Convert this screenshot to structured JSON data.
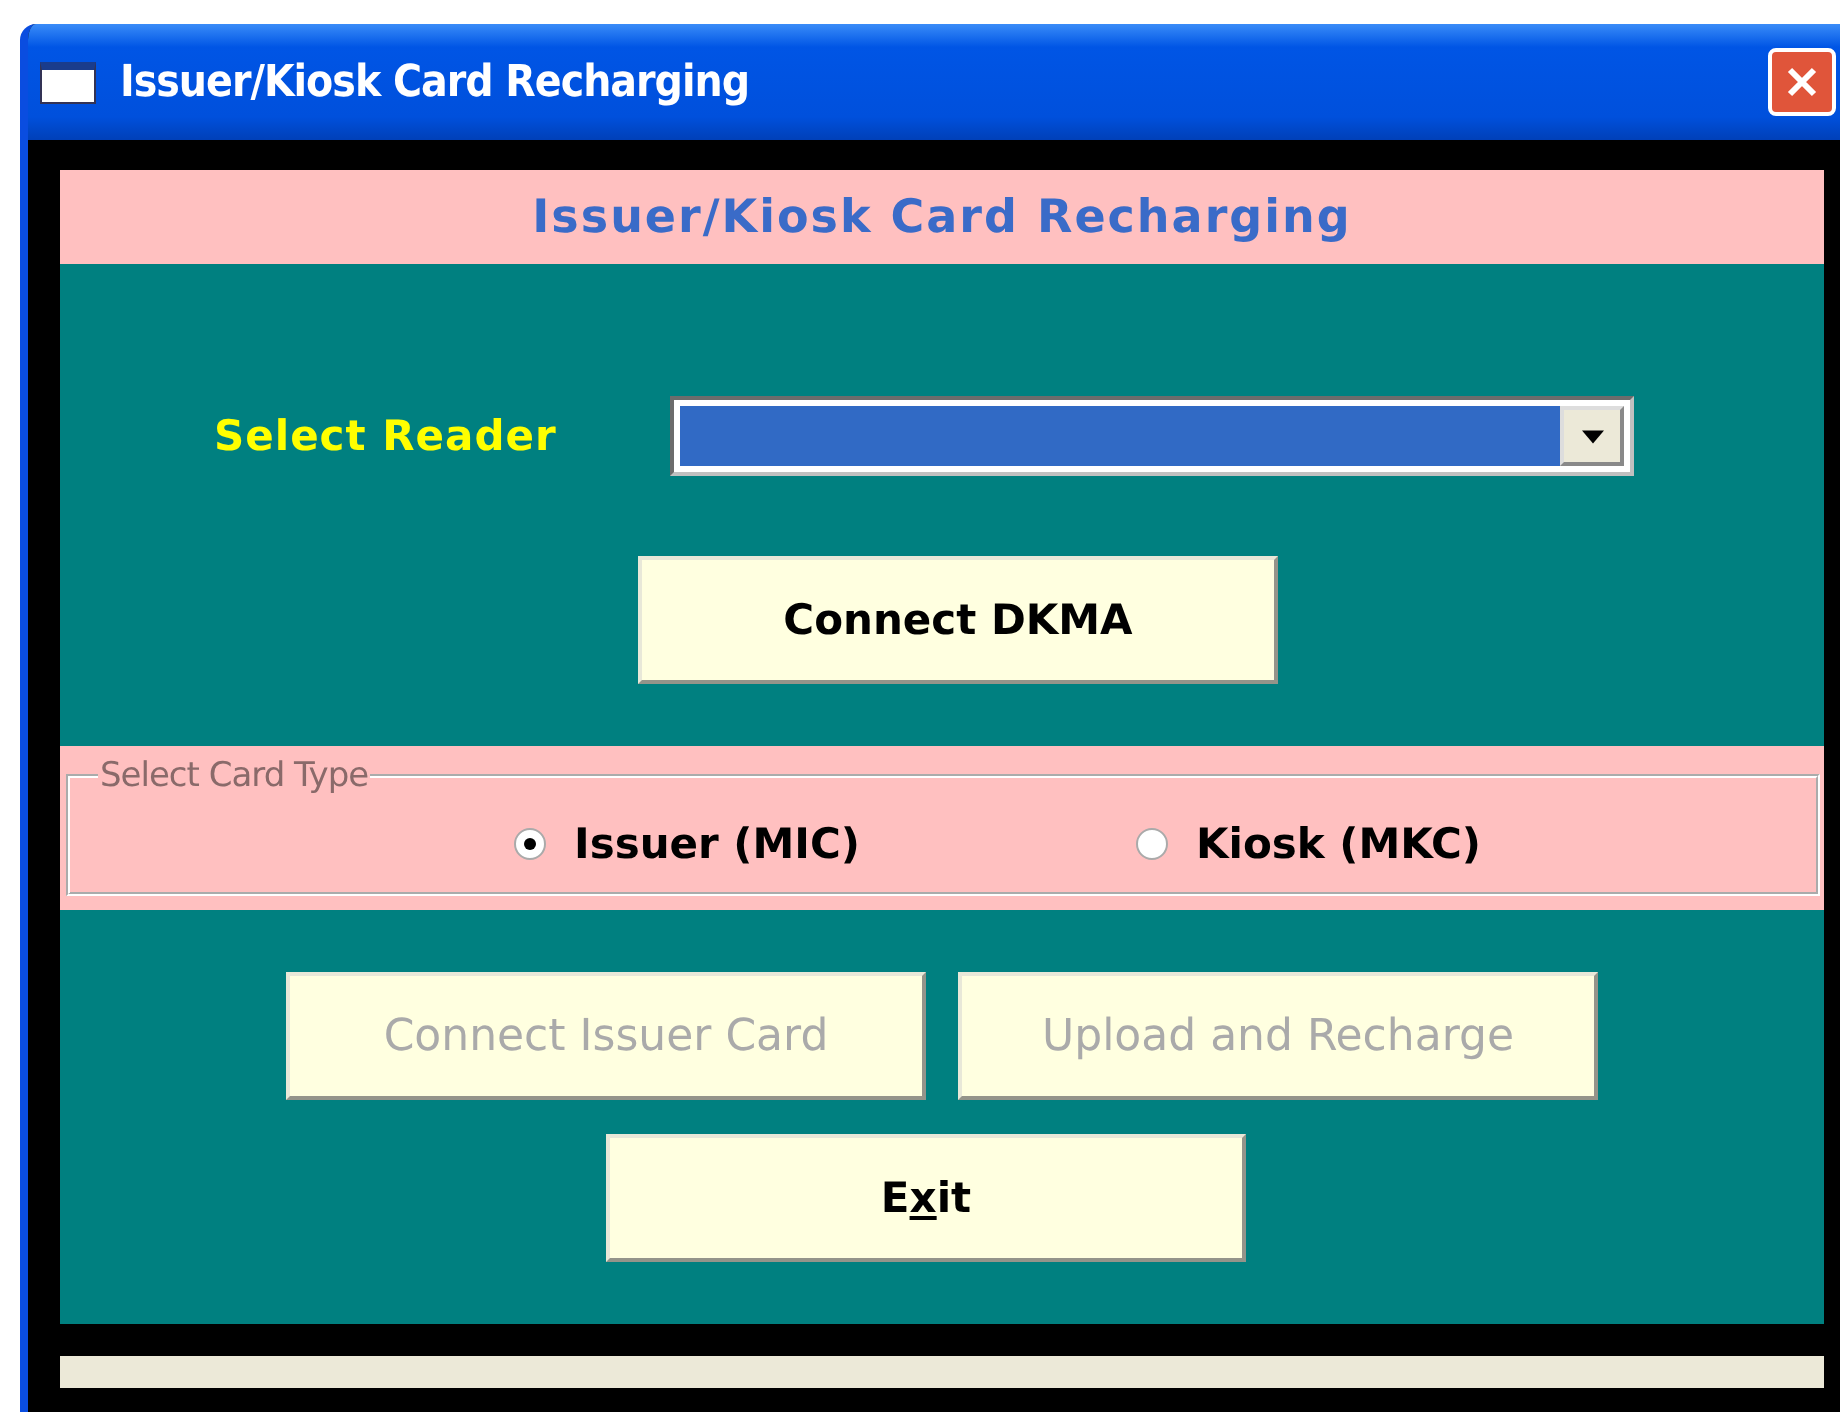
{
  "window": {
    "title": "Issuer/Kiosk Card Recharging"
  },
  "header": {
    "title": "Issuer/Kiosk Card Recharging"
  },
  "reader": {
    "label": "Select Reader",
    "focused": true
  },
  "connect_button": {
    "label": "Connect DKMA",
    "disabled": false
  },
  "card_type": {
    "legend": "Select Card Type",
    "options": [
      {
        "label": "Issuer (MIC)",
        "selected": true
      },
      {
        "label": "Kiosk (MKC)",
        "selected": false
      }
    ]
  },
  "card_buttons": [
    {
      "label": "Connect Issuer Card",
      "disabled": true
    },
    {
      "label": "Upload and Recharge",
      "disabled": true
    }
  ],
  "exit_button": {
    "label_before": "E",
    "access_key": "x",
    "label_after": "it",
    "disabled": false
  }
}
